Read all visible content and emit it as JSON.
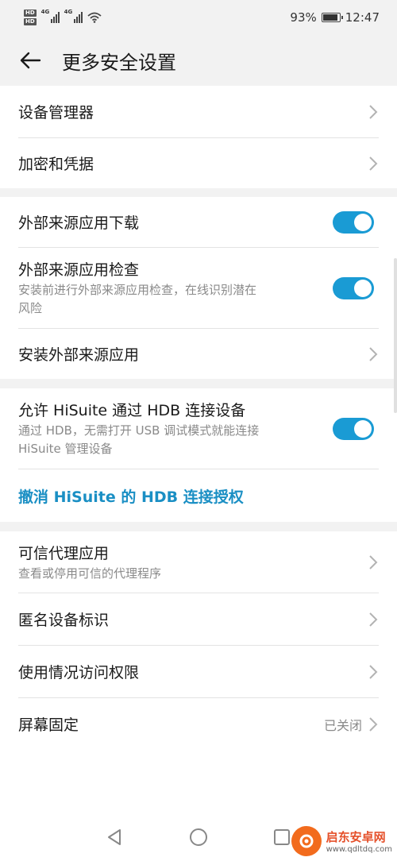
{
  "status_bar": {
    "hd1": "HD",
    "hd2": "HD",
    "net1": "4G",
    "net2": "4G",
    "battery_percent": "93%",
    "battery_level": 0.93,
    "time": "12:47"
  },
  "app_bar": {
    "title": "更多安全设置"
  },
  "section1": {
    "device_manager": "设备管理器",
    "encryption": "加密和凭据"
  },
  "section2": {
    "external_download": {
      "title": "外部来源应用下载",
      "enabled": true
    },
    "external_check": {
      "title": "外部来源应用检查",
      "subtitle_line1": "安装前进行外部来源应用检查，在线识别潜在",
      "subtitle_line2": "风险",
      "enabled": true
    },
    "install_external": "安装外部来源应用"
  },
  "section3": {
    "hisuite_hdb": {
      "title": "允许 HiSuite 通过 HDB 连接设备",
      "subtitle_line1": "通过 HDB，无需打开 USB 调试模式就能连接",
      "subtitle_line2": "HiSuite 管理设备",
      "enabled": true
    },
    "revoke_hdb": "撤消 HiSuite 的 HDB 连接授权"
  },
  "section4": {
    "trust_agents": {
      "title": "可信代理应用",
      "subtitle": "查看或停用可信的代理程序"
    },
    "anonymous_id": "匿名设备标识",
    "usage_access": "使用情况访问权限",
    "screen_pinning": {
      "title": "屏幕固定",
      "value": "已关闭"
    }
  },
  "watermark": {
    "title": "启东安卓网",
    "url": "www.qdltdq.com"
  },
  "colors": {
    "accent": "#1a9bd4",
    "link": "#1a8fc4",
    "background": "#f2f2f2",
    "card": "#ffffff"
  }
}
